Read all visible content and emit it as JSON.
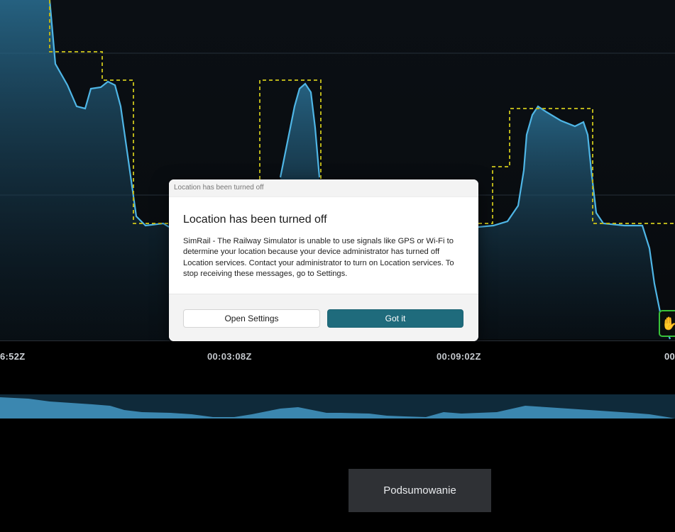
{
  "timeline": {
    "labels": [
      "6:52Z",
      "00:03:08Z",
      "00:09:02Z",
      "00"
    ]
  },
  "summary_button": {
    "label": "Podsumowanie"
  },
  "dialog": {
    "window_title": "Location has been turned off",
    "heading": "Location has been turned off",
    "body": "SimRail - The Railway Simulator is unable to use signals like GPS or Wi-Fi to determine your location because your device administrator has turned off Location services. Contact your administrator to turn on Location services. To stop receiving these messages, go to Settings.",
    "secondary_button": "Open Settings",
    "primary_button": "Got it"
  },
  "colors": {
    "speed_line": "#4fb6e6",
    "speed_fill": "#2a6f93",
    "limit_line": "#b8b21a",
    "primary_button": "#1f6b7c",
    "marker_border": "#39c23a"
  },
  "icons": {
    "marker": "hand-icon"
  }
}
